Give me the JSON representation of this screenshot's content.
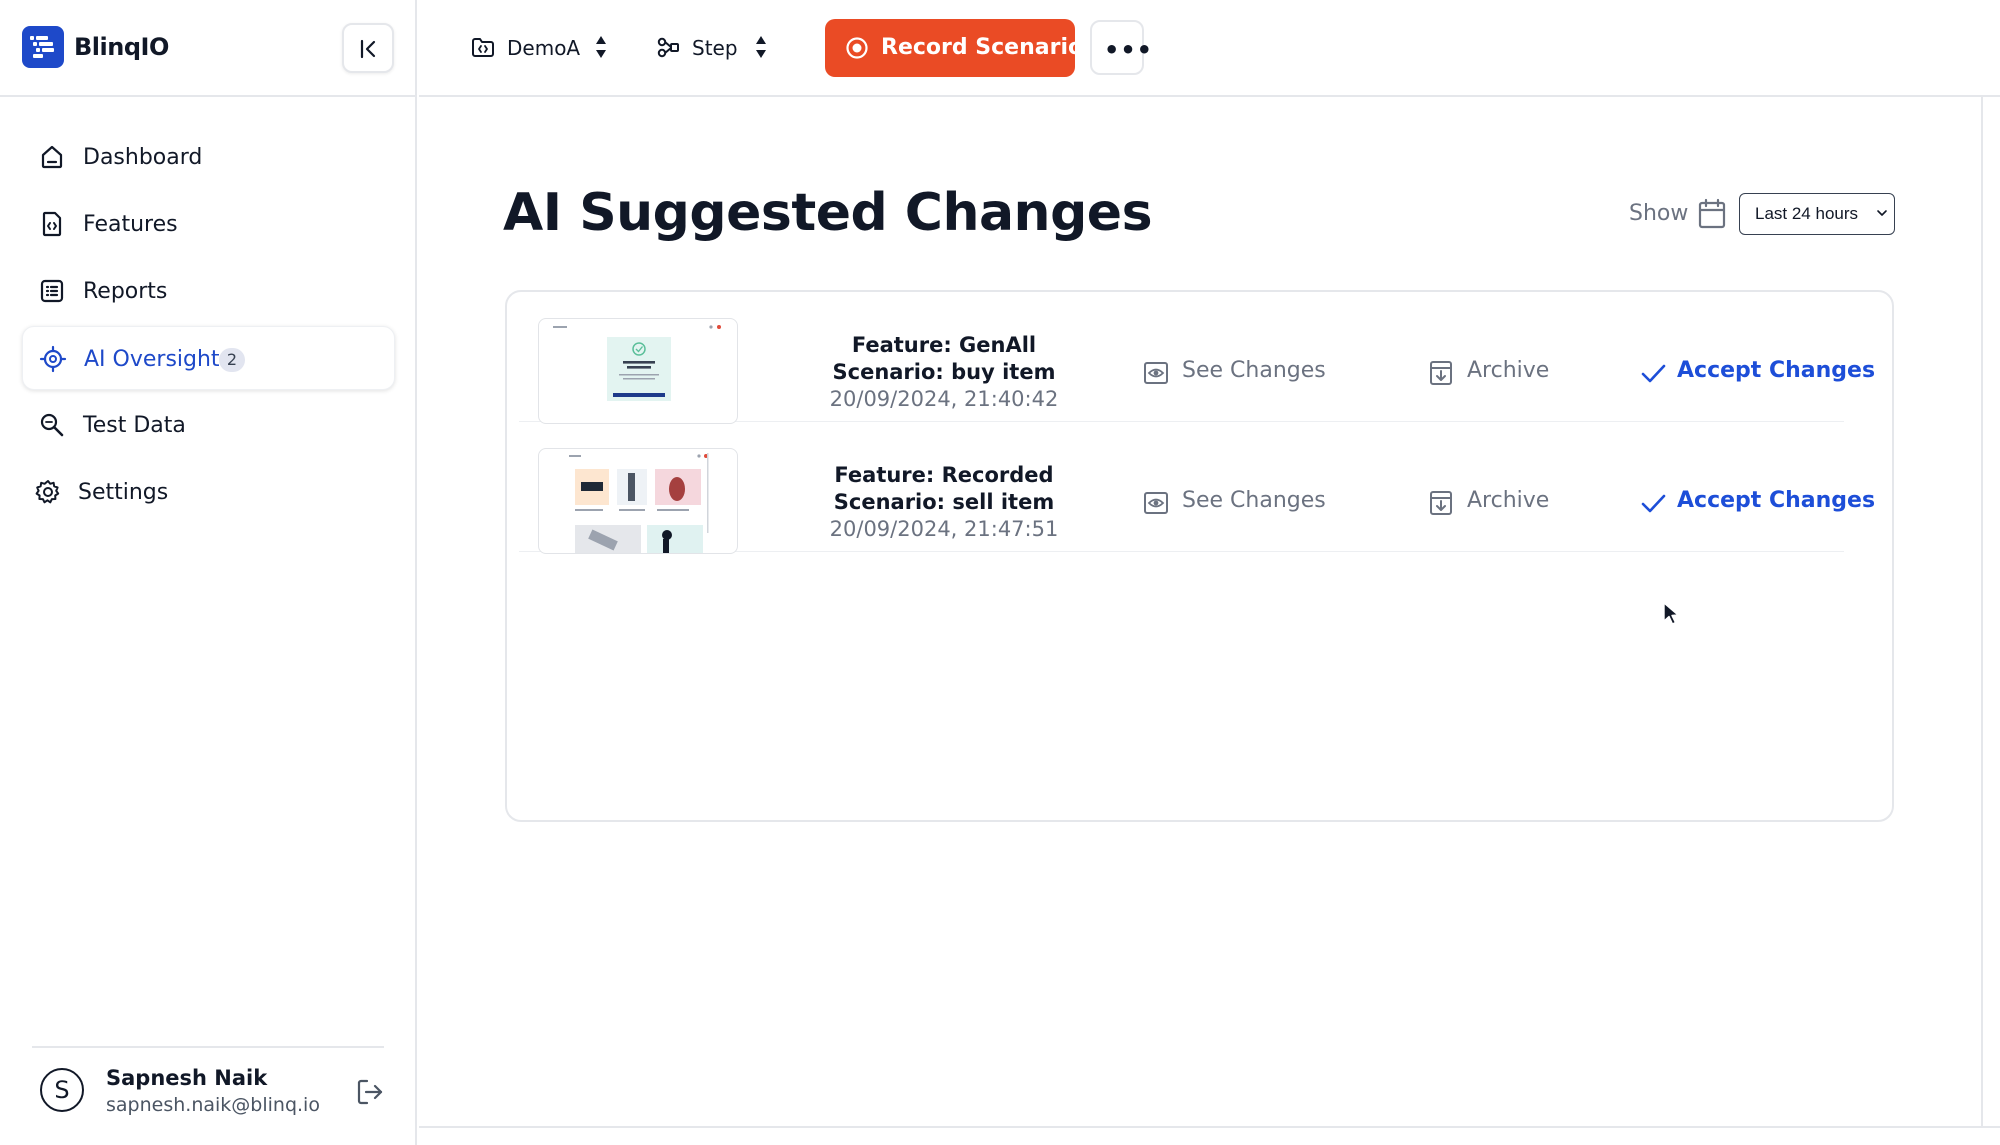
{
  "app": {
    "name": "BlinqIO"
  },
  "sidebar": {
    "items": [
      {
        "label": "Dashboard",
        "icon": "home-icon"
      },
      {
        "label": "Features",
        "icon": "file-code-icon"
      },
      {
        "label": "Reports",
        "icon": "list-icon"
      },
      {
        "label": "AI Oversight",
        "icon": "ai-chip-icon",
        "badge": "2",
        "active": true
      },
      {
        "label": "Test Data",
        "icon": "search-data-icon"
      },
      {
        "label": "Settings",
        "icon": "gear-icon"
      }
    ],
    "user": {
      "initial": "S",
      "name": "Sapnesh Naik",
      "email": "sapnesh.naik@blinq.io"
    }
  },
  "topbar": {
    "project": {
      "label": "DemoA",
      "icon": "project-icon"
    },
    "mode": {
      "label": "Step",
      "icon": "step-icon"
    },
    "record_label": "Record Scenario",
    "more_label": "•••"
  },
  "main": {
    "title": "AI Suggested Changes",
    "filter": {
      "show_label": "Show",
      "range": "Last 24 hours"
    },
    "rows": [
      {
        "feature": "Feature: GenAll",
        "scenario": "Scenario: buy item",
        "timestamp": "20/09/2024, 21:40:42",
        "see_changes": "See Changes",
        "archive": "Archive",
        "accept": "Accept Changes"
      },
      {
        "feature": "Feature: Recorded",
        "scenario": "Scenario: sell item",
        "timestamp": "20/09/2024, 21:47:51",
        "see_changes": "See Changes",
        "archive": "Archive",
        "accept": "Accept Changes"
      }
    ]
  },
  "colors": {
    "brand": "#1e49c9",
    "record": "#ea4b25",
    "accept": "#1d4ed8",
    "muted": "#6b7280"
  }
}
